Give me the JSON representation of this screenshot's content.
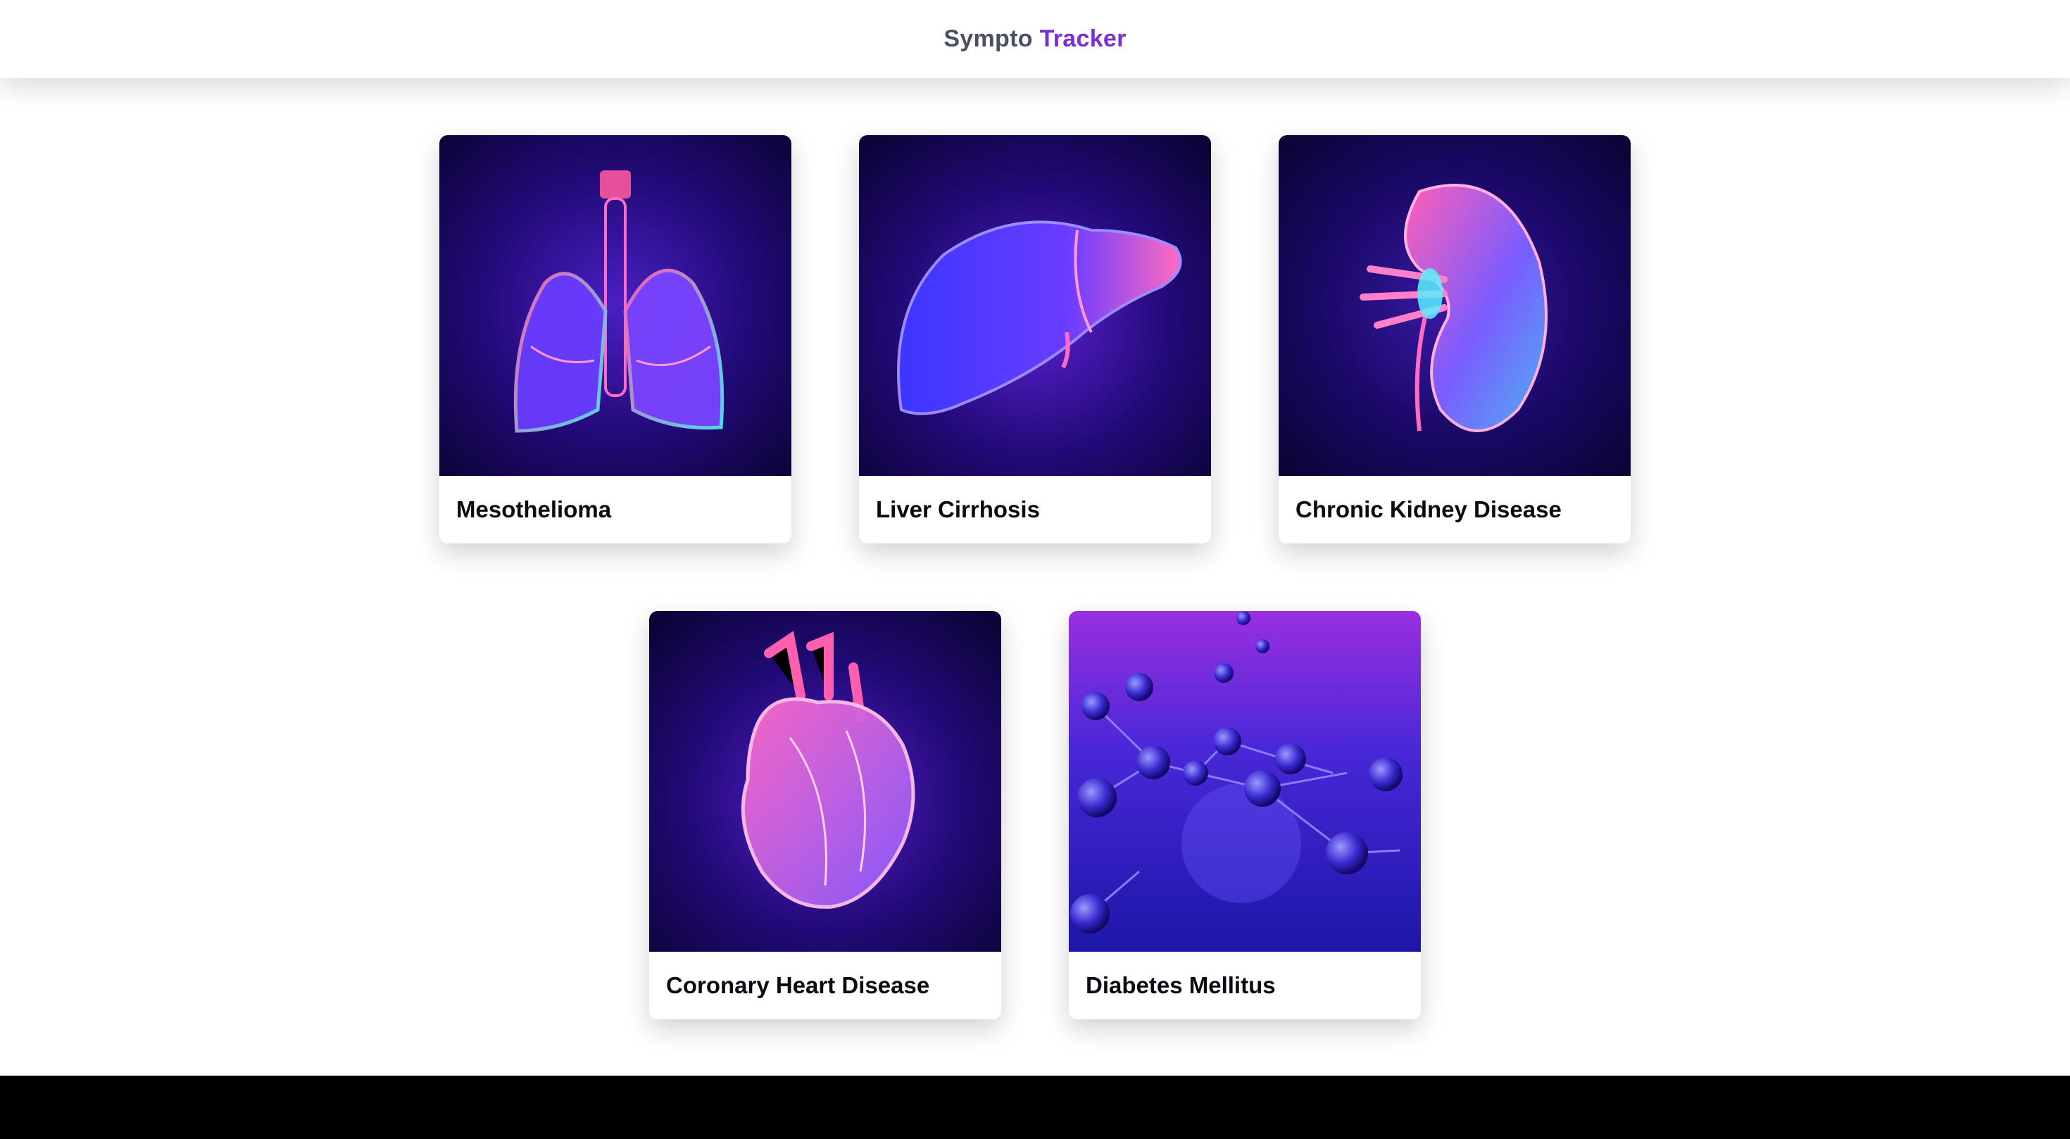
{
  "header": {
    "brand_part1": "Sympto",
    "brand_part2": "Tracker"
  },
  "colors": {
    "brand_dark": "#4a4f63",
    "brand_accent": "#7a2fd0",
    "footer": "#000000"
  },
  "cards": [
    {
      "title": "Mesothelioma",
      "icon": "lungs-illustration"
    },
    {
      "title": "Liver Cirrhosis",
      "icon": "liver-illustration"
    },
    {
      "title": "Chronic Kidney Disease",
      "icon": "kidney-illustration"
    },
    {
      "title": "Coronary Heart Disease",
      "icon": "heart-illustration"
    },
    {
      "title": "Diabetes Mellitus",
      "icon": "molecules-illustration"
    }
  ]
}
